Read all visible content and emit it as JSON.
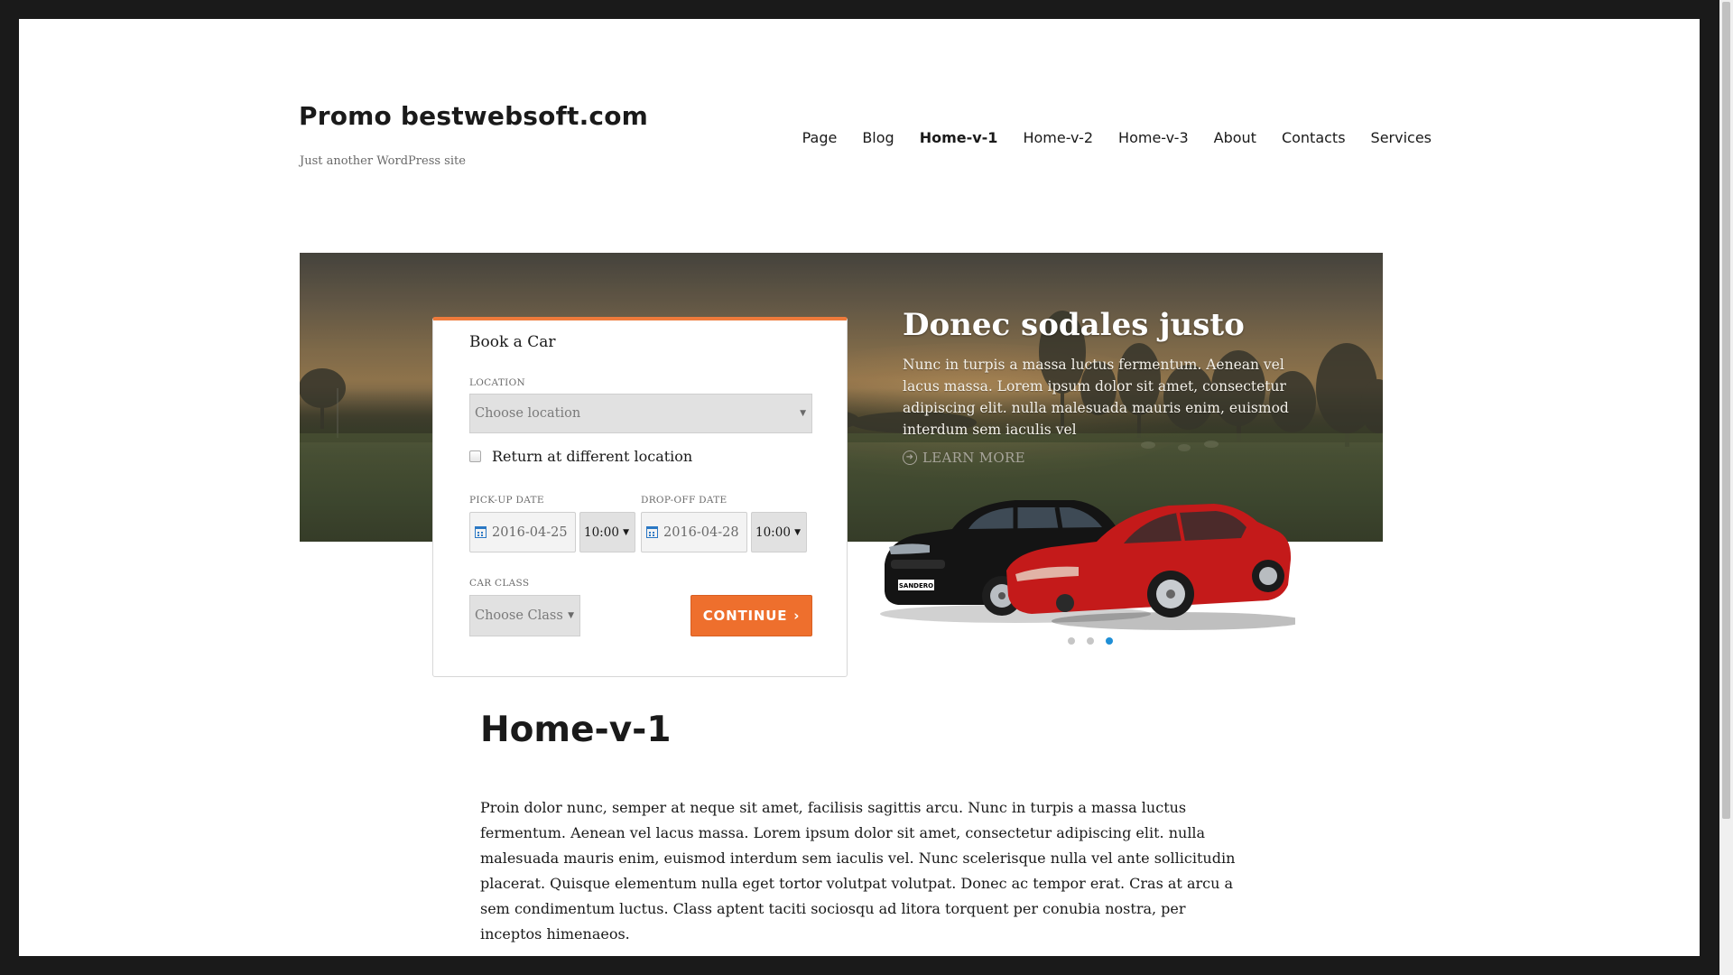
{
  "site": {
    "title": "Promo bestwebsoft.com",
    "tagline": "Just another WordPress site"
  },
  "nav": {
    "items": [
      {
        "label": "Page",
        "active": false
      },
      {
        "label": "Blog",
        "active": false
      },
      {
        "label": "Home-v-1",
        "active": true
      },
      {
        "label": "Home-v-2",
        "active": false
      },
      {
        "label": "Home-v-3",
        "active": false
      },
      {
        "label": "About",
        "active": false
      },
      {
        "label": "Contacts",
        "active": false
      },
      {
        "label": "Services",
        "active": false
      }
    ]
  },
  "slider": {
    "title": "Donec sodales justo",
    "text": "Nunc in turpis a massa luctus fermentum. Aenean vel lacus massa. Lorem ipsum dolor sit amet, consectetur adipiscing elit. nulla malesuada mauris enim, euismod interdum sem iaculis vel",
    "learn_more": "LEARN MORE",
    "dots": 3,
    "active_dot": 3,
    "car_plate": "SANDERO"
  },
  "booking": {
    "title": "Book a Car",
    "location_label": "LOCATION",
    "location_placeholder": "Choose location",
    "return_label": "Return at different location",
    "pickup_label": "PICK-UP DATE",
    "pickup_date": "2016-04-25",
    "pickup_time": "10:00",
    "dropoff_label": "DROP-OFF DATE",
    "dropoff_date": "2016-04-28",
    "dropoff_time": "10:00",
    "class_label": "CAR CLASS",
    "class_placeholder": "Choose Class",
    "continue_label": "CONTINUE",
    "continue_arrow": "›"
  },
  "content": {
    "heading": "Home-v-1",
    "body": "Proin dolor nunc, semper at neque sit amet, facilisis sagittis arcu. Nunc in turpis a massa luctus fermentum. Aenean vel lacus massa. Lorem ipsum dolor sit amet, consectetur adipiscing elit. nulla malesuada mauris enim, euismod interdum sem iaculis vel. Nunc scelerisque nulla vel ante sollicitudin placerat. Quisque elementum nulla eget tortor volutpat volutpat. Donec ac tempor erat. Cras at arcu a sem condimentum luctus. Class aptent taciti sociosqu ad litora torquent per conubia nostra, per inceptos himenaeos."
  },
  "colors": {
    "accent": "#ee6f2d",
    "active_dot": "#1f8fd6",
    "calendar_icon": "#2b78c4"
  }
}
